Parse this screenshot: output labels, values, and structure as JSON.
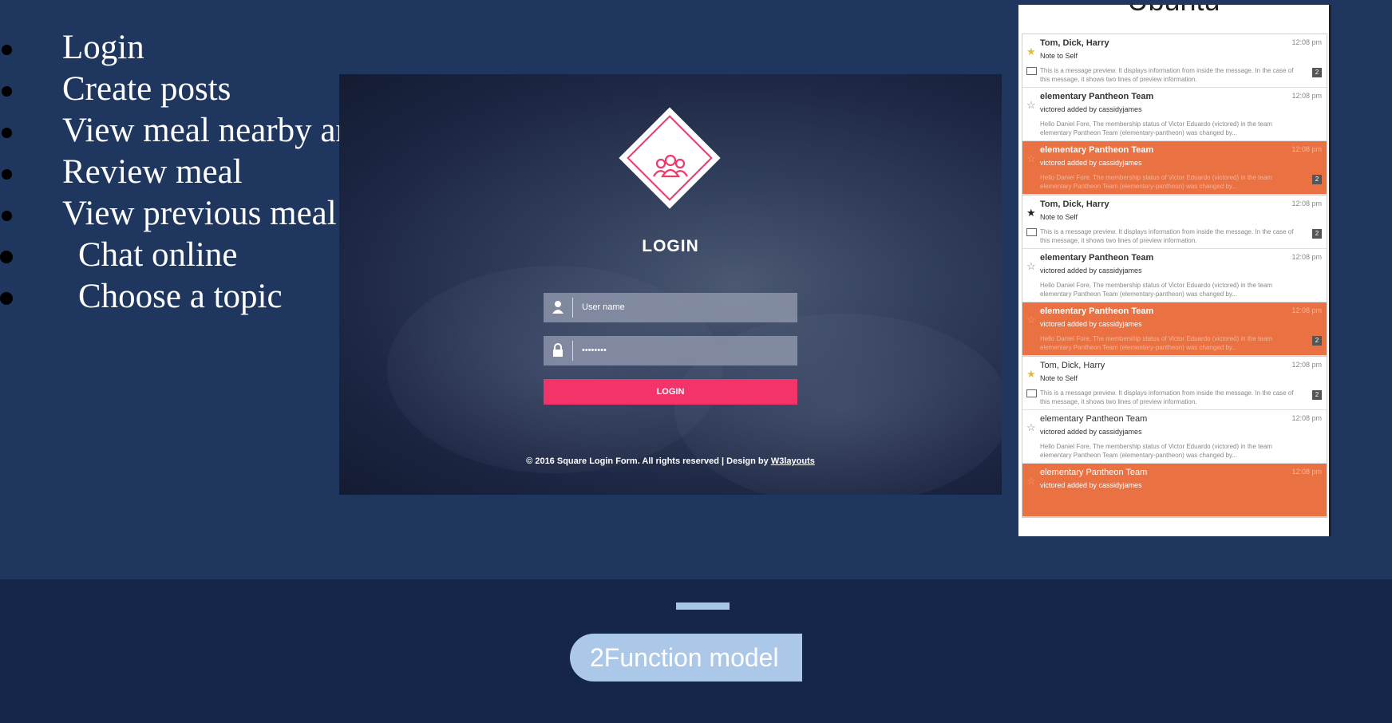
{
  "bullets": [
    {
      "text": "Login"
    },
    {
      "text": "Create posts"
    },
    {
      "text": "View meal nearby and Join a meal"
    },
    {
      "text": "Review meal"
    },
    {
      "text": "View previous meal"
    },
    {
      "text": "Chat online"
    },
    {
      "text": "Choose a topic"
    }
  ],
  "login": {
    "title": "LOGIN",
    "username_placeholder": "User name",
    "password_value": "••••••••",
    "button_label": "LOGIN",
    "footer_prefix": "© 2016 Square Login Form. All rights reserved | Design by ",
    "footer_link": "W3layouts",
    "accent_color": "#f4336a"
  },
  "mail": {
    "brand": "Ubuntu",
    "groups": [
      [
        {
          "sender": "Tom, Dick, Harry",
          "time": "12:08 pm",
          "subject": "Note to Self",
          "preview": "This is a message preview. It displays information from inside the message. In the case of this message, it shows two lines of preview information.",
          "badge": "2",
          "star": "gold-star-icon"
        },
        {
          "sender": "elementary Pantheon Team",
          "time": "12:08 pm",
          "subject": "victored added by cassidyjames",
          "preview": "Hello Daniel Fore, The membership status of Victor Eduardo (victored) in the team elementary Pantheon Team (elementary-pantheon) was changed by...",
          "badge": "",
          "star": "outline-star-icon"
        },
        {
          "sender": "elementary Pantheon Team",
          "time": "12:08 pm",
          "subject": "victored added by cassidyjames",
          "preview": "Hello Daniel Fore, The membership status of Victor Eduardo (victored) in the team elementary Pantheon Team (elementary-pantheon) was changed by...",
          "badge": "2",
          "star": "outline-star-icon",
          "highlight": true
        }
      ],
      [
        {
          "sender": "Tom, Dick, Harry",
          "time": "12:08 pm",
          "subject": "Note to Self",
          "preview": "This is a message preview. It displays information from inside the message. In the case of this message, it shows two lines of preview information.",
          "badge": "2",
          "star": "filled-star-icon"
        },
        {
          "sender": "elementary Pantheon Team",
          "time": "12:08 pm",
          "subject": "victored added by cassidyjames",
          "preview": "Hello Daniel Fore, The membership status of Victor Eduardo (victored) in the team elementary Pantheon Team (elementary-pantheon) was changed by...",
          "badge": "",
          "star": "outline-star-icon"
        },
        {
          "sender": "elementary Pantheon Team",
          "time": "12:08 pm",
          "subject": "victored added by cassidyjames",
          "preview": "Hello Daniel Fore, The membership status of Victor Eduardo (victored) in the team elementary Pantheon Team (elementary-pantheon) was changed by...",
          "badge": "2",
          "star": "outline-star-icon",
          "highlight": true
        }
      ],
      [
        {
          "sender": "Tom, Dick, Harry",
          "time": "12:08 pm",
          "subject": "Note to Self",
          "preview": "This is a message preview. It displays information from inside the message. In the case of this message, it shows two lines of preview information.",
          "badge": "2",
          "star": "gold-star-icon",
          "normal": true
        },
        {
          "sender": "elementary Pantheon Team",
          "time": "12:08 pm",
          "subject": "victored added by cassidyjames",
          "preview": "Hello Daniel Fore, The membership status of Victor Eduardo (victored) in the team elementary Pantheon Team (elementary-pantheon) was changed by...",
          "badge": "",
          "star": "outline-star-icon",
          "normal": true
        },
        {
          "sender": "elementary Pantheon Team",
          "time": "12:08 pm",
          "subject": "victored added by cassidyjames",
          "preview": "",
          "badge": "",
          "star": "outline-star-icon",
          "highlight": true,
          "normal": true
        }
      ]
    ]
  },
  "footer": {
    "number": "2",
    "label": "Function model",
    "pill_color": "#acc8e8"
  }
}
